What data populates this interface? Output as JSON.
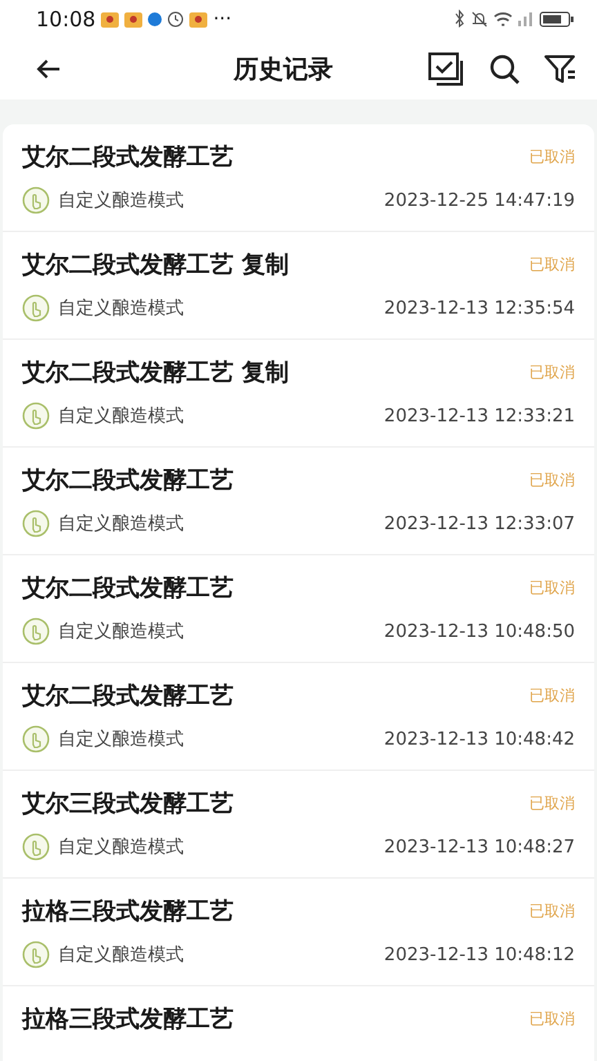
{
  "status_bar": {
    "time": "10:08",
    "more": "···"
  },
  "nav": {
    "title": "历史记录"
  },
  "records": [
    {
      "title": "艾尔二段式发酵工艺",
      "status": "已取消",
      "mode": "自定义酿造模式",
      "time": "2023-12-25 14:47:19"
    },
    {
      "title": "艾尔二段式发酵工艺 复制",
      "status": "已取消",
      "mode": "自定义酿造模式",
      "time": "2023-12-13 12:35:54"
    },
    {
      "title": "艾尔二段式发酵工艺 复制",
      "status": "已取消",
      "mode": "自定义酿造模式",
      "time": "2023-12-13 12:33:21"
    },
    {
      "title": "艾尔二段式发酵工艺",
      "status": "已取消",
      "mode": "自定义酿造模式",
      "time": "2023-12-13 12:33:07"
    },
    {
      "title": "艾尔二段式发酵工艺",
      "status": "已取消",
      "mode": "自定义酿造模式",
      "time": "2023-12-13 10:48:50"
    },
    {
      "title": "艾尔二段式发酵工艺",
      "status": "已取消",
      "mode": "自定义酿造模式",
      "time": "2023-12-13 10:48:42"
    },
    {
      "title": "艾尔三段式发酵工艺",
      "status": "已取消",
      "mode": "自定义酿造模式",
      "time": "2023-12-13 10:48:27"
    },
    {
      "title": "拉格三段式发酵工艺",
      "status": "已取消",
      "mode": "自定义酿造模式",
      "time": "2023-12-13 10:48:12"
    },
    {
      "title": "拉格三段式发酵工艺",
      "status": "已取消"
    }
  ]
}
